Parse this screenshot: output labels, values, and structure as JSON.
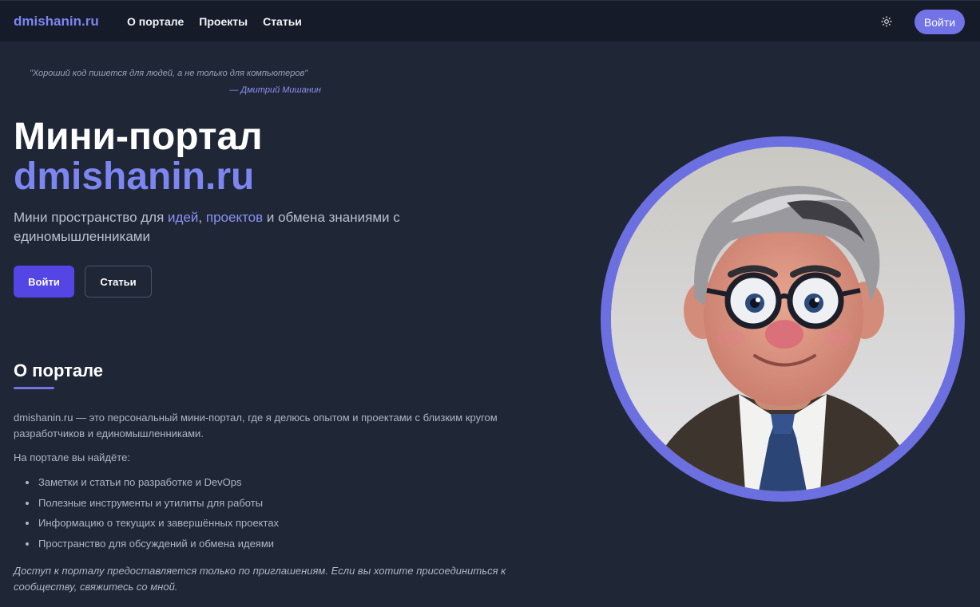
{
  "header": {
    "brand": "dmishanin.ru",
    "nav": [
      "О портале",
      "Проекты",
      "Статьи"
    ],
    "theme_icon": "sun-icon",
    "login_label": "Войти"
  },
  "hero": {
    "quote": "\"Хороший код пишется для людей, а не только для компьютеров\"",
    "quote_author": "— Дмитрий Мишанин",
    "title_line1": "Мини-портал",
    "title_line2": "dmishanin.ru",
    "subtitle_part1": "Мини пространство для ",
    "subtitle_hl1": "идей",
    "subtitle_part2": ", ",
    "subtitle_hl2": "проектов",
    "subtitle_part3": " и обмена знаниями с единомышленниками",
    "primary_button": "Войти",
    "secondary_button": "Статьи"
  },
  "about": {
    "title": "О портале",
    "description": "dmishanin.ru — это персональный мини-портал, где я делюсь опытом и проектами с близким кругом разработчиков и единомышленниками.",
    "find_intro": "На портале вы найдёте:",
    "features": [
      "Заметки и статьи по разработке и DevOps",
      "Полезные инструменты и утилиты для работы",
      "Информацию о текущих и завершённых проектах",
      "Пространство для обсуждений и обмена идеями"
    ],
    "note": "Доступ к порталу предоставляется только по приглашениям. Если вы хотите присоединиться к сообществу, свяжитесь со мной."
  },
  "colors": {
    "accent": "#7c85f0",
    "primary_button": "#5446e5",
    "background": "#1f2636",
    "header": "#151b28"
  }
}
